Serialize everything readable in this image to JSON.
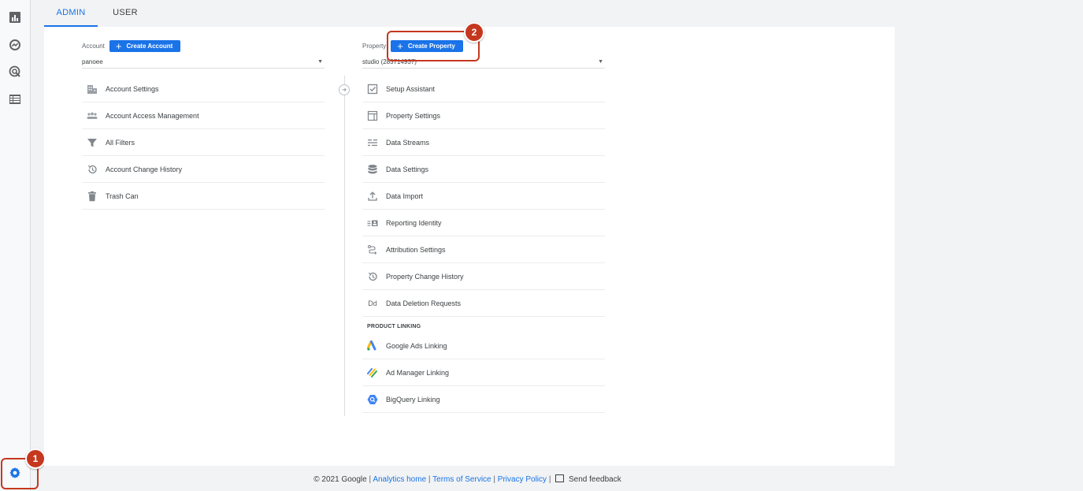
{
  "tabs": [
    {
      "label": "ADMIN",
      "active": true
    },
    {
      "label": "USER",
      "active": false
    }
  ],
  "rail": {
    "icons": [
      "reports-icon",
      "explore-icon",
      "advertising-icon",
      "configure-icon"
    ],
    "settings_icon": "gear-icon"
  },
  "account": {
    "label": "Account",
    "create_button": "Create Account",
    "selected": "panoee",
    "items": [
      {
        "label": "Account Settings",
        "icon": "building-icon"
      },
      {
        "label": "Account Access Management",
        "icon": "people-icon"
      },
      {
        "label": "All Filters",
        "icon": "filter-icon"
      },
      {
        "label": "Account Change History",
        "icon": "history-icon"
      },
      {
        "label": "Trash Can",
        "icon": "trash-icon"
      }
    ]
  },
  "property": {
    "label": "Property",
    "create_button": "Create Property",
    "selected": "studio (283714937)",
    "items": [
      {
        "label": "Setup Assistant",
        "icon": "checkbox-icon"
      },
      {
        "label": "Property Settings",
        "icon": "layout-icon"
      },
      {
        "label": "Data Streams",
        "icon": "streams-icon"
      },
      {
        "label": "Data Settings",
        "icon": "database-icon"
      },
      {
        "label": "Data Import",
        "icon": "upload-icon"
      },
      {
        "label": "Reporting Identity",
        "icon": "identity-icon"
      },
      {
        "label": "Attribution Settings",
        "icon": "attribution-icon"
      },
      {
        "label": "Property Change History",
        "icon": "history-icon"
      },
      {
        "label": "Data Deletion Requests",
        "icon": "dd-icon"
      }
    ],
    "product_linking_label": "PRODUCT LINKING",
    "linking_items": [
      {
        "label": "Google Ads Linking",
        "icon": "google-ads-icon"
      },
      {
        "label": "Ad Manager Linking",
        "icon": "ad-manager-icon"
      },
      {
        "label": "BigQuery Linking",
        "icon": "bigquery-icon"
      }
    ]
  },
  "footer": {
    "copyright": "© 2021 Google",
    "analytics_home": "Analytics home",
    "terms": "Terms of Service",
    "privacy": "Privacy Policy",
    "feedback": "Send feedback"
  },
  "annotations": [
    {
      "number": "1"
    },
    {
      "number": "2"
    }
  ],
  "colors": {
    "accent": "#1a73e8",
    "annotation": "#c5381f"
  }
}
